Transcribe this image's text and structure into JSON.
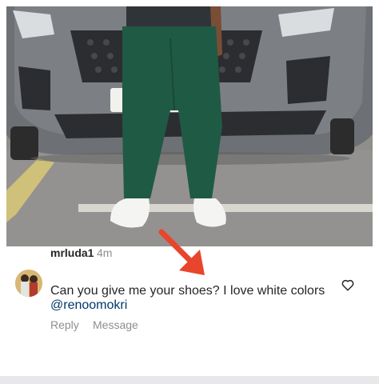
{
  "comment": {
    "username": "mrluda1",
    "time": "4m",
    "text": "Can you give me your shoes? I love white colors",
    "mention": "@renoomokri",
    "actions": {
      "reply": "Reply",
      "message": "Message"
    }
  },
  "colors": {
    "arrow": "#e8452c",
    "mention": "#00376b",
    "muted": "#8e8e8e",
    "text": "#262626"
  },
  "icons": {
    "like": "heart-outline-icon",
    "pointer": "red-arrow"
  }
}
